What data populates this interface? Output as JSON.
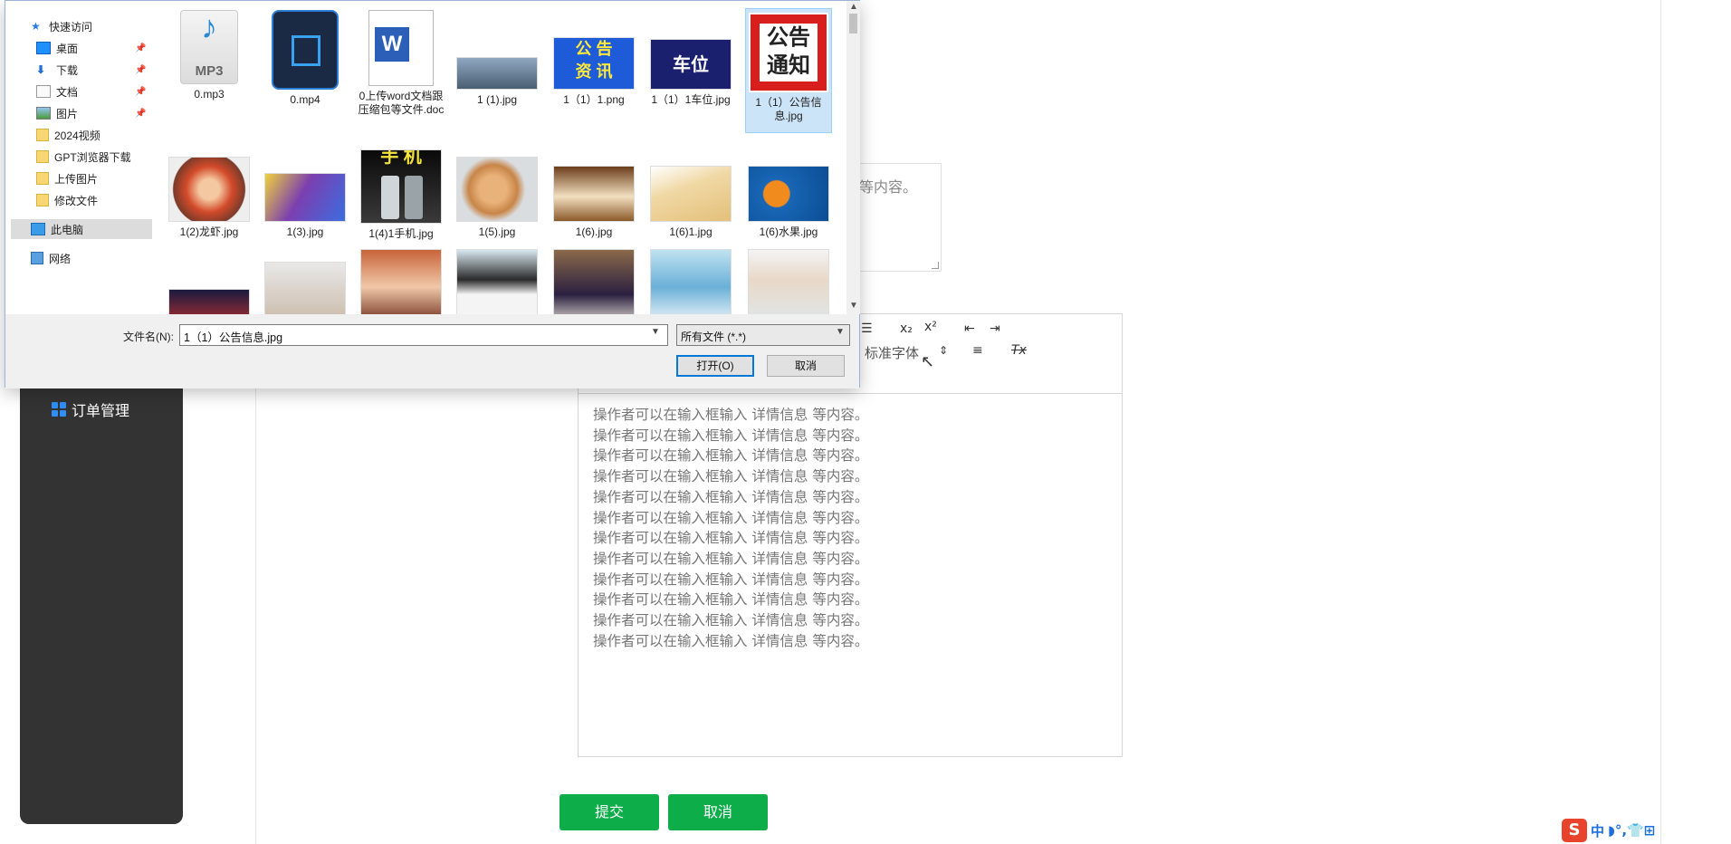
{
  "background_page": {
    "sidebar": {
      "menu_item": "订单管理"
    },
    "top_textarea_placeholder": "等内容。",
    "editor": {
      "toolbar": {
        "subscript_label": "x₂",
        "superscript_label": "x²",
        "font_select_value": "标准字体",
        "font_select_arrow": "⇕",
        "clear_format_label": "Tx"
      },
      "lines": [
        "操作者可以在输入框输入  详情信息  等内容。",
        "操作者可以在输入框输入  详情信息  等内容。",
        "操作者可以在输入框输入  详情信息  等内容。",
        "操作者可以在输入框输入  详情信息  等内容。",
        "操作者可以在输入框输入  详情信息  等内容。",
        "操作者可以在输入框输入  详情信息  等内容。",
        "操作者可以在输入框输入  详情信息  等内容。",
        "操作者可以在输入框输入  详情信息  等内容。",
        "操作者可以在输入框输入  详情信息  等内容。",
        "操作者可以在输入框输入  详情信息  等内容。",
        "操作者可以在输入框输入  详情信息  等内容。",
        "操作者可以在输入框输入  详情信息  等内容。"
      ]
    },
    "submit_label": "提交",
    "cancel_label": "取消",
    "tray": {
      "ime_logo": "S",
      "ime_mode": "中",
      "symbols": "◗°,👕⊞"
    }
  },
  "file_dialog": {
    "nav": {
      "quick_access": "快速访问",
      "items": [
        {
          "label": "桌面",
          "pinned": true
        },
        {
          "label": "下载",
          "pinned": true
        },
        {
          "label": "文档",
          "pinned": true
        },
        {
          "label": "图片",
          "pinned": true
        },
        {
          "label": "2024视频",
          "pinned": false
        },
        {
          "label": "GPT浏览器下载",
          "pinned": false
        },
        {
          "label": "上传图片",
          "pinned": false
        },
        {
          "label": "修改文件",
          "pinned": false
        }
      ],
      "this_pc": "此电脑",
      "network": "网络"
    },
    "files_row1": [
      {
        "name": "0.mp3",
        "thumb_text": "MP3"
      },
      {
        "name": "0.mp4",
        "thumb_text": ""
      },
      {
        "name": "0上传word文档跟压缩包等文件.doc",
        "thumb_text": "W"
      },
      {
        "name": "1 (1).jpg",
        "thumb_text": ""
      },
      {
        "name": "1（1）1.png",
        "thumb_text": "公 告\n资 讯"
      },
      {
        "name": "1（1）1车位.jpg",
        "thumb_text": "车位"
      },
      {
        "name": "1（1）公告信息.jpg",
        "thumb_text": "公告\n通知"
      }
    ],
    "files_row2": [
      {
        "name": "1(2)龙虾.jpg"
      },
      {
        "name": "1(3).jpg"
      },
      {
        "name": "1(4)1手机.jpg",
        "thumb_text": "手 机"
      },
      {
        "name": "1(5).jpg"
      },
      {
        "name": "1(6).jpg"
      },
      {
        "name": "1(6)1.jpg"
      },
      {
        "name": "1(6)水果.jpg"
      }
    ],
    "filename_label": "文件名(N):",
    "filename_value": "1（1）公告信息.jpg",
    "filetype_value": "所有文件 (*.*)",
    "open_label": "打开(O)",
    "cancel_label": "取消"
  },
  "colors": {
    "sidebar_bg": "#333333",
    "accent_green": "#0dae4a",
    "selection_blue": "#cce4f7"
  }
}
